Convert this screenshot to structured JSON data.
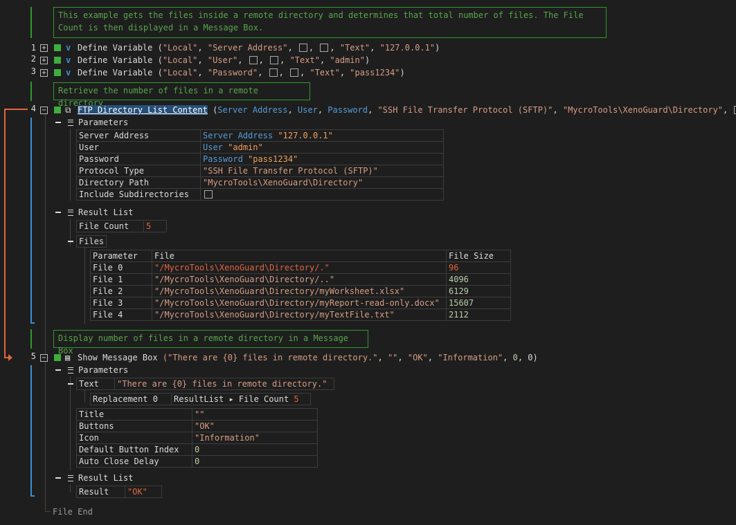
{
  "comments": {
    "c1": "This example gets the files inside a remote directory and determines that total number of files. The File Count is then displayed in a Message Box.",
    "c2": "Retrieve the number of files in a remote directory",
    "c3": "Display number of files in a remote directory in a Message Box"
  },
  "lines": {
    "l1": {
      "num": "1",
      "cmd": "Define Variable",
      "args": [
        "\"Local\"",
        "\"Server Address\"",
        "\"Text\"",
        "\"127.0.0.1\""
      ]
    },
    "l2": {
      "num": "2",
      "cmd": "Define Variable",
      "args": [
        "\"Local\"",
        "\"User\"",
        "\"Text\"",
        "\"admin\""
      ]
    },
    "l3": {
      "num": "3",
      "cmd": "Define Variable",
      "args": [
        "\"Local\"",
        "\"Password\"",
        "\"Text\"",
        "\"pass1234\""
      ]
    },
    "l4": {
      "num": "4",
      "cmd": "FTP Directory List Content",
      "open": " (",
      "a1": "Server Address",
      "a2": "User",
      "a3": "Password",
      "a4": "\"SSH File Transfer Protocol (SFTP)\"",
      "a5": "\"MycroTools\\XenoGuard\\Directory\"",
      "close": ")"
    },
    "l5": {
      "num": "5",
      "cmd": "Show Message Box",
      "args": [
        "(\"There are {0} files in remote directory.\"",
        "\"\"",
        "\"OK\"",
        "\"Information\"",
        "0",
        "0)"
      ]
    }
  },
  "ftp": {
    "parameters_label": "Parameters",
    "params": [
      {
        "k": "Server Address",
        "v1": "Server Address",
        "v2": "\"127.0.0.1\""
      },
      {
        "k": "User",
        "v1": "User",
        "v2": "\"admin\""
      },
      {
        "k": "Password",
        "v1": "Password",
        "v2": "\"pass1234\""
      },
      {
        "k": "Protocol Type",
        "v2": "\"SSH File Transfer Protocol (SFTP)\""
      },
      {
        "k": "Directory Path",
        "v2": "\"MycroTools\\XenoGuard\\Directory\""
      },
      {
        "k": "Include Subdirectories"
      }
    ],
    "result_list_label": "Result List",
    "file_count_label": "File Count",
    "file_count_value": "5",
    "files_label": "Files",
    "files_headers": [
      "Parameter",
      "File",
      "File Size"
    ],
    "files": [
      {
        "p": "File 0",
        "f": "\"/MycroTools\\XenoGuard\\Directory/.\"",
        "s": "96"
      },
      {
        "p": "File 1",
        "f": "\"/MycroTools\\XenoGuard\\Directory/..\"",
        "s": "4096"
      },
      {
        "p": "File 2",
        "f": "\"/MycroTools\\XenoGuard\\Directory/myWorksheet.xlsx\"",
        "s": "6129"
      },
      {
        "p": "File 3",
        "f": "\"/MycroTools\\XenoGuard\\Directory/myReport-read-only.docx\"",
        "s": "15607"
      },
      {
        "p": "File 4",
        "f": "\"/MycroTools\\XenoGuard\\Directory/myTextFile.txt\"",
        "s": "2112"
      }
    ]
  },
  "msg": {
    "parameters_label": "Parameters",
    "text_label": "Text",
    "text_value": "\"There are {0} files in remote directory.\"",
    "replacement_label": "Replacement 0",
    "replacement_value": "ResultList ▸ File Count",
    "replacement_num": "5",
    "params": [
      {
        "k": "Title",
        "v": "\"\""
      },
      {
        "k": "Buttons",
        "v": "\"OK\""
      },
      {
        "k": "Icon",
        "v": "\"Information\""
      },
      {
        "k": "Default Button Index",
        "v": "0"
      },
      {
        "k": "Auto Close Delay",
        "v": "0"
      }
    ],
    "result_list_label": "Result List",
    "result_label": "Result",
    "result_value": "\"OK\""
  },
  "file_end": "File End"
}
